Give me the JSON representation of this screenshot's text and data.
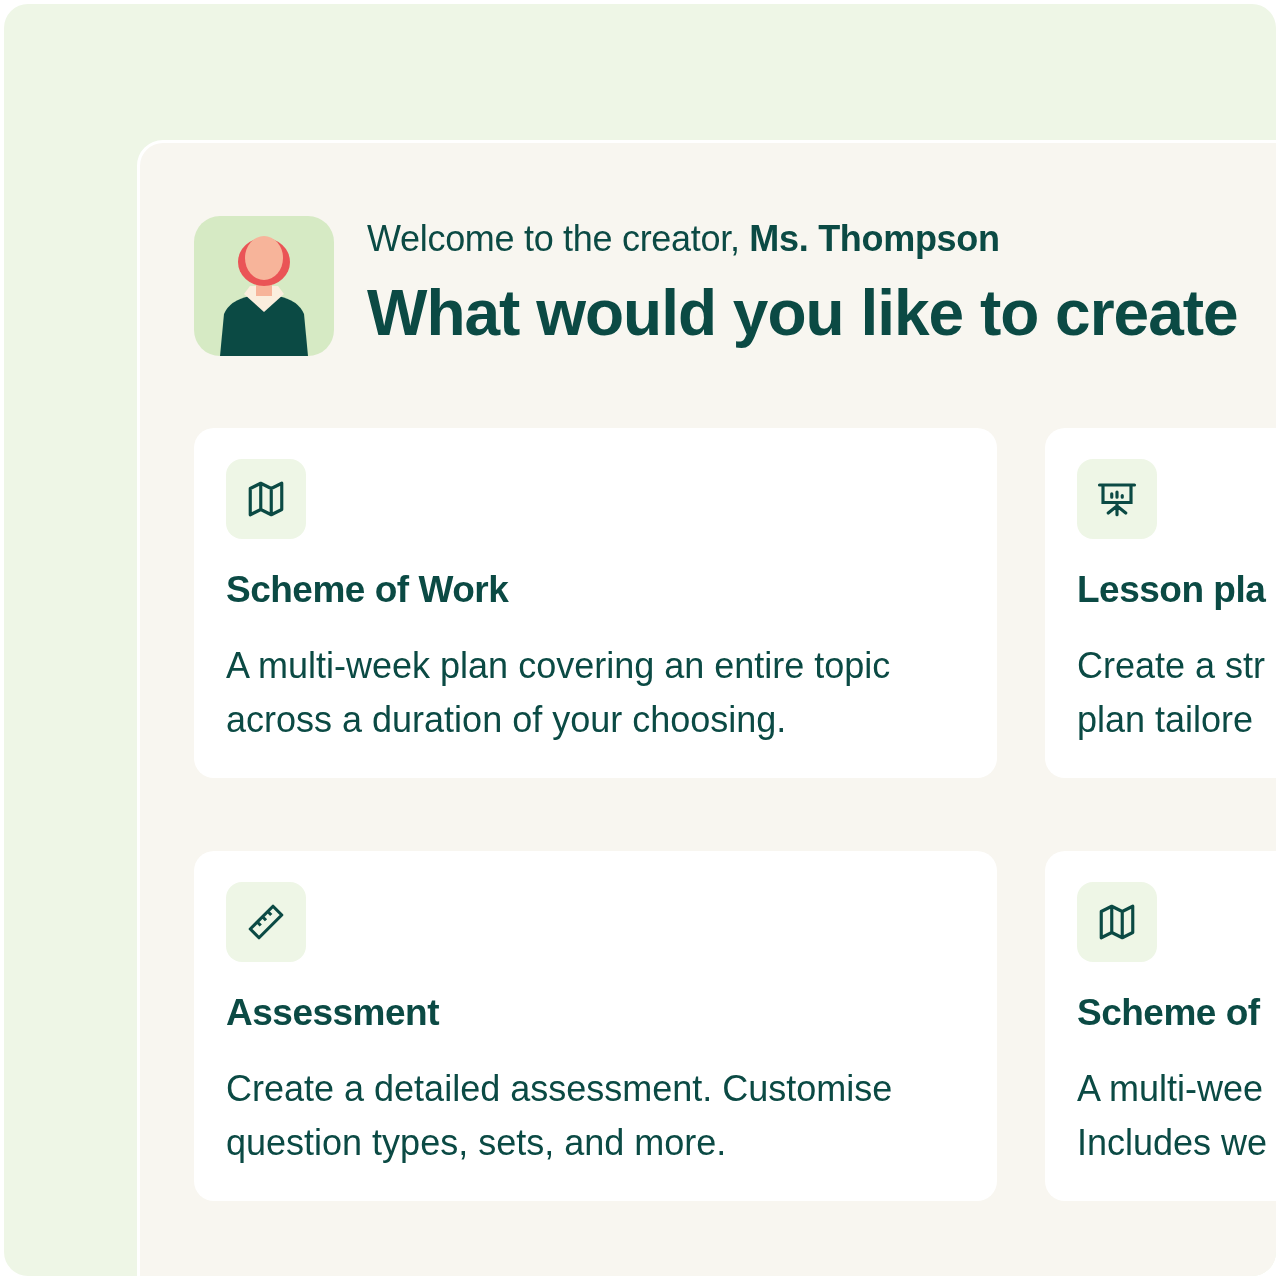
{
  "header": {
    "welcome": "Welcome to the creator, **Ms. Thompson**",
    "heading": "What would you like to create"
  },
  "cards": [
    {
      "kind": "map",
      "title": "Scheme of Work",
      "description_lines": [
        "A multi-week plan covering an entire topic",
        "across a duration of your choosing."
      ]
    },
    {
      "kind": "presentation",
      "title": "Lesson pla",
      "description_lines": [
        "Create a str",
        "plan tailore"
      ]
    },
    {
      "kind": "ruler",
      "title": "Assessment",
      "description_lines": [
        "Create a detailed assessment. Customise",
        "question types, sets, and more."
      ]
    },
    {
      "kind": "map",
      "title": "Scheme of",
      "description_lines": [
        "A multi-wee",
        "Includes we"
      ]
    }
  ]
}
